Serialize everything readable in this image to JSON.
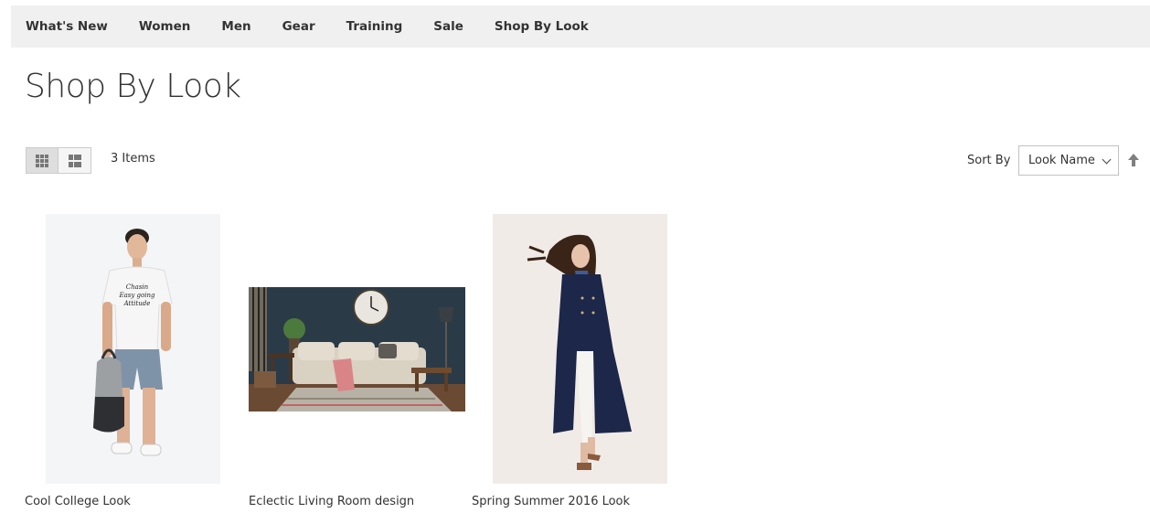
{
  "nav": {
    "items": [
      {
        "label": "What's New"
      },
      {
        "label": "Women"
      },
      {
        "label": "Men"
      },
      {
        "label": "Gear"
      },
      {
        "label": "Training"
      },
      {
        "label": "Sale"
      },
      {
        "label": "Shop By Look"
      }
    ]
  },
  "page": {
    "title": "Shop By Look"
  },
  "toolbar": {
    "view_modes": [
      "grid-icon",
      "list-icon"
    ],
    "active_view": "grid",
    "items_count": "3 Items",
    "sort_label": "Sort By",
    "sort_selected": "Look Name",
    "sort_direction": "ascending"
  },
  "looks": [
    {
      "name": "Cool College Look",
      "image": "man-with-backpack-photo"
    },
    {
      "name": "Eclectic Living Room design",
      "image": "living-room-photo"
    },
    {
      "name": "Spring Summer 2016 Look",
      "image": "woman-in-navy-coat-photo"
    }
  ]
}
